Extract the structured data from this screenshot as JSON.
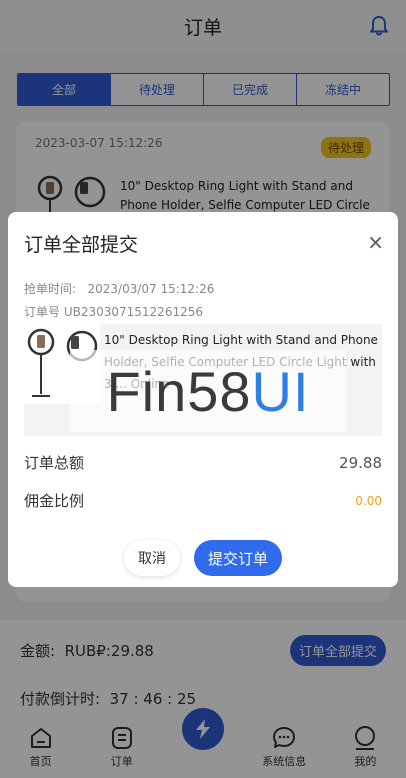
{
  "header": {
    "title": "订单"
  },
  "tabs": [
    {
      "label": "全部"
    },
    {
      "label": "待处理"
    },
    {
      "label": "已完成"
    },
    {
      "label": "冻结中"
    }
  ],
  "order": {
    "time": "2023-03-07 15:12:26",
    "status": "待处理",
    "title": "10\" Desktop Ring Light with Stand and Phone Holder, Selfie Computer LED Circle"
  },
  "footer": {
    "amount_label": "金额:",
    "amount_value": "RUB₽:29.88",
    "submit_all": "订单全部提交",
    "countdown_label": "付款倒计时:",
    "countdown_value": "37 : 46 : 25"
  },
  "nav": [
    {
      "label": "首页",
      "icon": "home-icon"
    },
    {
      "label": "订单",
      "icon": "order-icon"
    },
    {
      "label": "",
      "icon": "lightning-icon"
    },
    {
      "label": "系统信息",
      "icon": "message-icon"
    },
    {
      "label": "我的",
      "icon": "user-icon"
    }
  ],
  "modal": {
    "title": "订单全部提交",
    "close": "×",
    "grab_time_label": "抢单时间:",
    "grab_time_value": "2023/03/07 15:12:26",
    "order_no": "订单号 UB2303071512261256",
    "product_title": "10\" Desktop Ring Light with Stand and Phone Holder, Selfie Computer LED Circle Light with 3 ... Online",
    "total_label": "订单总额",
    "total_value": "29.88",
    "commission_label": "佣金比例",
    "commission_value": "0.00",
    "cancel": "取消",
    "submit": "提交订单",
    "watermark_a": "Fin58",
    "watermark_b": "UI"
  },
  "colors": {
    "primary": "#2f5bd3",
    "badge": "#f3c623",
    "commission": "#f0a020"
  }
}
